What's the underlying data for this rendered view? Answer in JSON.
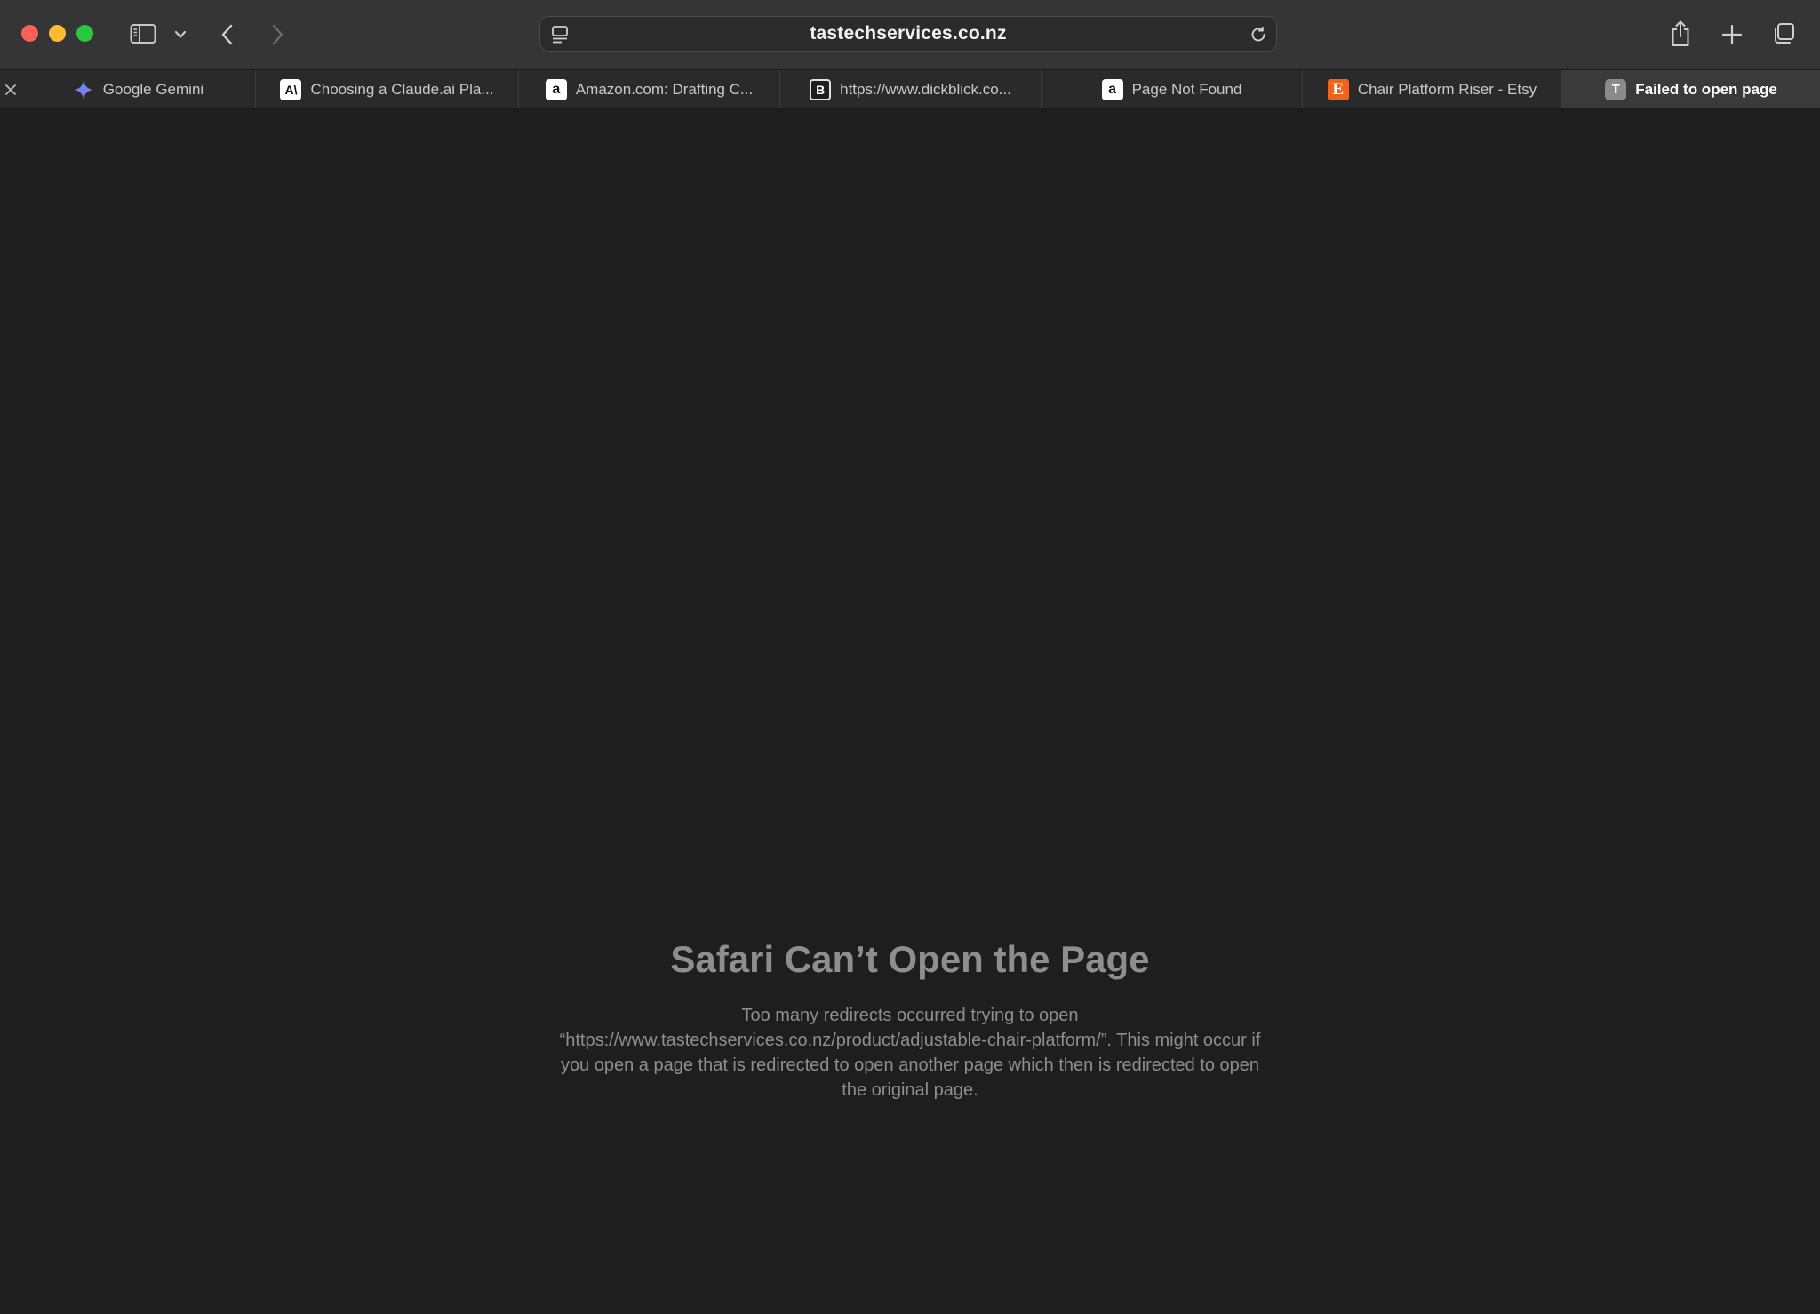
{
  "browser": {
    "address": "tastechservices.co.nz"
  },
  "tabs": [
    {
      "label": "Google Gemini",
      "icon": "gemini-star-icon",
      "active": false
    },
    {
      "label": "Choosing a Claude.ai Pla...",
      "icon": "anthropic-icon",
      "favicon_text": "A\\",
      "active": false
    },
    {
      "label": "Amazon.com: Drafting C...",
      "icon": "amazon-icon",
      "favicon_text": "a",
      "active": false
    },
    {
      "label": "https://www.dickblick.co...",
      "icon": "blick-icon",
      "favicon_text": "B",
      "active": false
    },
    {
      "label": "Page Not Found",
      "icon": "amazon-icon",
      "favicon_text": "a",
      "active": false
    },
    {
      "label": "Chair Platform Riser - Etsy",
      "icon": "etsy-icon",
      "favicon_text": "E",
      "active": false
    },
    {
      "label": "Failed to open page",
      "icon": "tab-letter-icon",
      "favicon_text": "T",
      "active": true
    }
  ],
  "error": {
    "title": "Safari Can’t Open the Page",
    "message": "Too many redirects occurred trying to open “https://www.tastechservices.co.nz/product/adjustable-chair-platform/”. This might occur if you open a page that is redirected to open another page which then is redirected to open the original page."
  },
  "colors": {
    "background": "#1e1e1e",
    "toolbar": "#353535",
    "tabbar": "#2a2a2a",
    "active_tab": "#3a3a3a",
    "error_text": "#8e8e8e",
    "traffic_close": "#fe5f57",
    "traffic_minimize": "#febc2e",
    "traffic_maximize": "#28c840"
  }
}
